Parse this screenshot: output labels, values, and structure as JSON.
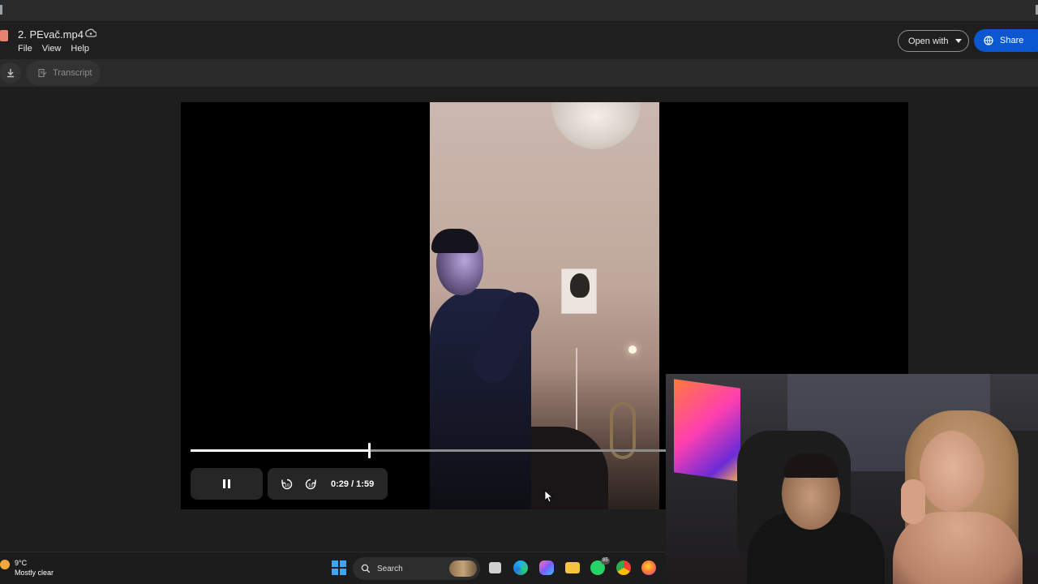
{
  "header": {
    "file_title": "2. PEvač.mp4",
    "menu": [
      "File",
      "View",
      "Help"
    ],
    "open_with_label": "Open with",
    "share_label": "Share"
  },
  "toolbar": {
    "transcript_label": "Transcript"
  },
  "player": {
    "current_time": "0:29",
    "duration": "1:59",
    "time_display": "0:29  / 1:59",
    "progress_fraction": 0.375
  },
  "taskbar": {
    "weather_temp": "9°C",
    "weather_desc": "Mostly clear",
    "search_label": "Search",
    "whatsapp_badge": "85"
  },
  "colors": {
    "share_blue": "#0b57d0",
    "windows_blue": "#3ea7f2"
  }
}
